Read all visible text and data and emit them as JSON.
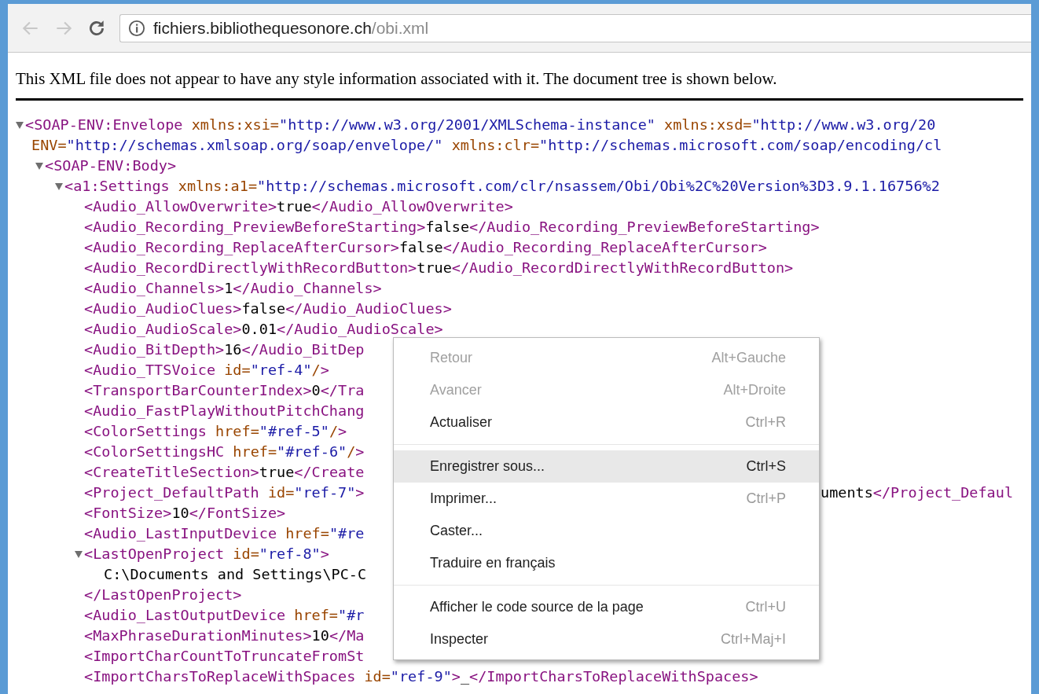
{
  "toolbar": {
    "back": {
      "disabled": true
    },
    "forward": {
      "disabled": true
    },
    "url": {
      "host": "fichiers.bibliothequesonore.ch",
      "path": "/obi.xml"
    }
  },
  "notice": "This XML file does not appear to have any style information associated with it. The document tree is shown below.",
  "tree": {
    "open_lines": [
      "<SOAP-ENV:Envelope xmlns:xsi=\"http://www.w3.org/2001/XMLSchema-instance\" xmlns:xsd=\"http://www.w3.org/20",
      "ENV=\"http://schemas.xmlsoap.org/soap/envelope/\" xmlns:clr=\"http://schemas.microsoft.com/soap/encoding/cl"
    ],
    "expanded": true,
    "children": [
      {
        "open_lines": [
          "<SOAP-ENV:Body>"
        ],
        "expanded": true,
        "children": [
          {
            "open_lines": [
              "<a1:Settings xmlns:a1=\"http://schemas.microsoft.com/clr/nsassem/Obi/Obi%2C%20Version%3D3.9.1.16756%2"
            ],
            "expanded": true,
            "children": [
              {
                "text": "<Audio_AllowOverwrite>true</Audio_AllowOverwrite>"
              },
              {
                "text": "<Audio_Recording_PreviewBeforeStarting>false</Audio_Recording_PreviewBeforeStarting>"
              },
              {
                "text": "<Audio_Recording_ReplaceAfterCursor>false</Audio_Recording_ReplaceAfterCursor>"
              },
              {
                "text": "<Audio_RecordDirectlyWithRecordButton>true</Audio_RecordDirectlyWithRecordButton>"
              },
              {
                "text": "<Audio_Channels>1</Audio_Channels>"
              },
              {
                "text": "<Audio_AudioClues>false</Audio_AudioClues>"
              },
              {
                "text": "<Audio_AudioScale>0.01</Audio_AudioScale>"
              },
              {
                "text": "<Audio_BitDepth>16</Audio_BitDep"
              },
              {
                "text": "<Audio_TTSVoice id=\"ref-4\"/>"
              },
              {
                "text": "<TransportBarCounterIndex>0</Tra"
              },
              {
                "text": "<Audio_FastPlayWithoutPitchChang"
              },
              {
                "text": "<ColorSettings href=\"#ref-5\"/>"
              },
              {
                "text": "<ColorSettingsHC href=\"#ref-6\"/>"
              },
              {
                "text": "<CreateTitleSection>true</Create"
              },
              {
                "text": "<Project_DefaultPath id=\"ref-7\">",
                "tail": "uments</Project_Defaul"
              },
              {
                "text": "<FontSize>10</FontSize>"
              },
              {
                "text": "<Audio_LastInputDevice href=\"#re"
              },
              {
                "open_lines": [
                  "<LastOpenProject id=\"ref-8\">"
                ],
                "expanded": true,
                "children": [
                  {
                    "text": "C:\\Documents and Settings\\PC-C"
                  }
                ],
                "close": "</LastOpenProject>"
              },
              {
                "text": "<Audio_LastOutputDevice href=\"#r"
              },
              {
                "text": "<MaxPhraseDurationMinutes>10</Ma"
              },
              {
                "text": "<ImportCharCountToTruncateFromSt"
              },
              {
                "text": "<ImportCharsToReplaceWithSpaces id=\"ref-9\">_</ImportCharsToReplaceWithSpaces>"
              }
            ]
          }
        ]
      }
    ]
  },
  "menu": {
    "groups": [
      [
        {
          "label": "Retour",
          "shortcut": "Alt+Gauche",
          "disabled": true,
          "selected": false
        },
        {
          "label": "Avancer",
          "shortcut": "Alt+Droite",
          "disabled": true,
          "selected": false
        },
        {
          "label": "Actualiser",
          "shortcut": "Ctrl+R",
          "disabled": false,
          "selected": false
        }
      ],
      [
        {
          "label": "Enregistrer sous...",
          "shortcut": "Ctrl+S",
          "disabled": false,
          "selected": true
        },
        {
          "label": "Imprimer...",
          "shortcut": "Ctrl+P",
          "disabled": false,
          "selected": false
        },
        {
          "label": "Caster...",
          "disabled": false,
          "selected": false
        },
        {
          "label": "Traduire en français",
          "disabled": false,
          "selected": false
        }
      ],
      [
        {
          "label": "Afficher le code source de la page",
          "shortcut": "Ctrl+U",
          "disabled": false,
          "selected": false
        },
        {
          "label": "Inspecter",
          "shortcut": "Ctrl+Maj+I",
          "disabled": false,
          "selected": false
        }
      ]
    ]
  }
}
